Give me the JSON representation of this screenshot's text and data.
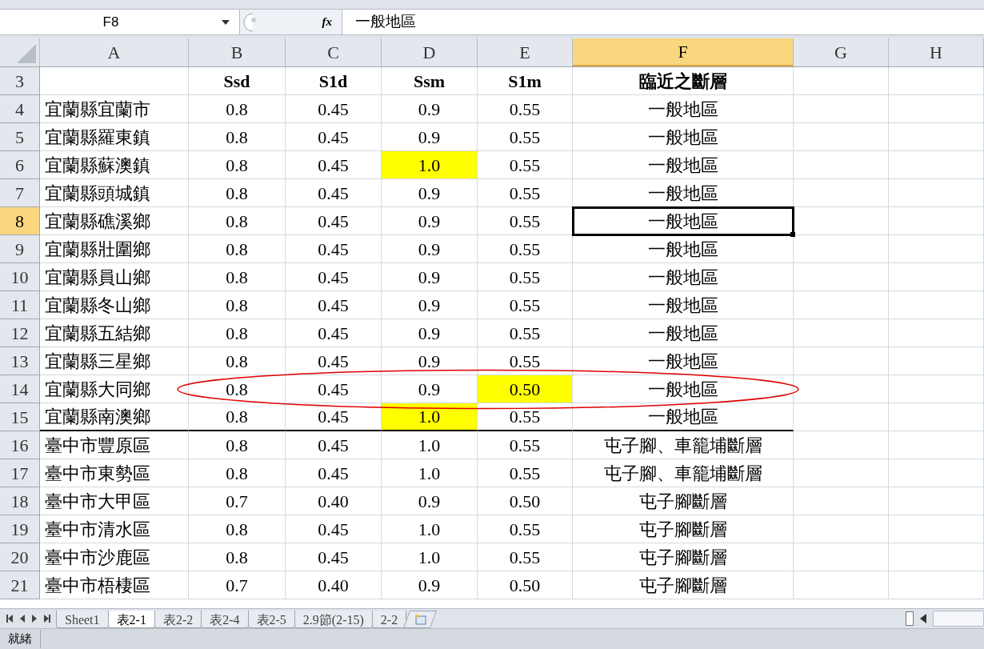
{
  "formula_bar": {
    "name_box": "F8",
    "fx": "fx",
    "formula": "一般地區"
  },
  "columns": [
    {
      "label": "A",
      "selected": false
    },
    {
      "label": "B",
      "selected": false
    },
    {
      "label": "C",
      "selected": false
    },
    {
      "label": "D",
      "selected": false
    },
    {
      "label": "E",
      "selected": false
    },
    {
      "label": "F",
      "selected": true
    },
    {
      "label": "G",
      "selected": false
    },
    {
      "label": "H",
      "selected": false
    }
  ],
  "rows": [
    {
      "number": "3",
      "kind": "header",
      "selected": false,
      "circled": false,
      "border_below": false,
      "cells": [
        {
          "text": "",
          "highlighted": false
        },
        {
          "text": "Ssd",
          "highlighted": false
        },
        {
          "text": "S1d",
          "highlighted": false
        },
        {
          "text": "Ssm",
          "highlighted": false
        },
        {
          "text": "S1m",
          "highlighted": false
        },
        {
          "text": "臨近之斷層",
          "highlighted": false
        }
      ]
    },
    {
      "number": "4",
      "kind": "data",
      "selected": false,
      "circled": false,
      "border_below": false,
      "cells": [
        {
          "text": "宜蘭縣宜蘭市",
          "highlighted": false
        },
        {
          "text": "0.8",
          "highlighted": false
        },
        {
          "text": "0.45",
          "highlighted": false
        },
        {
          "text": "0.9",
          "highlighted": false
        },
        {
          "text": "0.55",
          "highlighted": false
        },
        {
          "text": "一般地區",
          "highlighted": false
        }
      ]
    },
    {
      "number": "5",
      "kind": "data",
      "selected": false,
      "circled": false,
      "border_below": false,
      "cells": [
        {
          "text": "宜蘭縣羅東鎮",
          "highlighted": false
        },
        {
          "text": "0.8",
          "highlighted": false
        },
        {
          "text": "0.45",
          "highlighted": false
        },
        {
          "text": "0.9",
          "highlighted": false
        },
        {
          "text": "0.55",
          "highlighted": false
        },
        {
          "text": "一般地區",
          "highlighted": false
        }
      ]
    },
    {
      "number": "6",
      "kind": "data",
      "selected": false,
      "circled": false,
      "border_below": false,
      "cells": [
        {
          "text": "宜蘭縣蘇澳鎮",
          "highlighted": false
        },
        {
          "text": "0.8",
          "highlighted": false
        },
        {
          "text": "0.45",
          "highlighted": false
        },
        {
          "text": "1.0",
          "highlighted": true
        },
        {
          "text": "0.55",
          "highlighted": false
        },
        {
          "text": "一般地區",
          "highlighted": false
        }
      ]
    },
    {
      "number": "7",
      "kind": "data",
      "selected": false,
      "circled": false,
      "border_below": false,
      "cells": [
        {
          "text": "宜蘭縣頭城鎮",
          "highlighted": false
        },
        {
          "text": "0.8",
          "highlighted": false
        },
        {
          "text": "0.45",
          "highlighted": false
        },
        {
          "text": "0.9",
          "highlighted": false
        },
        {
          "text": "0.55",
          "highlighted": false
        },
        {
          "text": "一般地區",
          "highlighted": false
        }
      ]
    },
    {
      "number": "8",
      "kind": "data",
      "selected": true,
      "circled": false,
      "border_below": false,
      "cells": [
        {
          "text": "宜蘭縣礁溪鄉",
          "highlighted": false
        },
        {
          "text": "0.8",
          "highlighted": false
        },
        {
          "text": "0.45",
          "highlighted": false
        },
        {
          "text": "0.9",
          "highlighted": false
        },
        {
          "text": "0.55",
          "highlighted": false
        },
        {
          "text": "一般地區",
          "highlighted": false,
          "selected": true
        }
      ]
    },
    {
      "number": "9",
      "kind": "data",
      "selected": false,
      "circled": false,
      "border_below": false,
      "cells": [
        {
          "text": "宜蘭縣壯圍鄉",
          "highlighted": false
        },
        {
          "text": "0.8",
          "highlighted": false
        },
        {
          "text": "0.45",
          "highlighted": false
        },
        {
          "text": "0.9",
          "highlighted": false
        },
        {
          "text": "0.55",
          "highlighted": false
        },
        {
          "text": "一般地區",
          "highlighted": false
        }
      ]
    },
    {
      "number": "10",
      "kind": "data",
      "selected": false,
      "circled": false,
      "border_below": false,
      "cells": [
        {
          "text": "宜蘭縣員山鄉",
          "highlighted": false
        },
        {
          "text": "0.8",
          "highlighted": false
        },
        {
          "text": "0.45",
          "highlighted": false
        },
        {
          "text": "0.9",
          "highlighted": false
        },
        {
          "text": "0.55",
          "highlighted": false
        },
        {
          "text": "一般地區",
          "highlighted": false
        }
      ]
    },
    {
      "number": "11",
      "kind": "data",
      "selected": false,
      "circled": false,
      "border_below": false,
      "cells": [
        {
          "text": "宜蘭縣冬山鄉",
          "highlighted": false
        },
        {
          "text": "0.8",
          "highlighted": false
        },
        {
          "text": "0.45",
          "highlighted": false
        },
        {
          "text": "0.9",
          "highlighted": false
        },
        {
          "text": "0.55",
          "highlighted": false
        },
        {
          "text": "一般地區",
          "highlighted": false
        }
      ]
    },
    {
      "number": "12",
      "kind": "data",
      "selected": false,
      "circled": false,
      "border_below": false,
      "cells": [
        {
          "text": "宜蘭縣五結鄉",
          "highlighted": false
        },
        {
          "text": "0.8",
          "highlighted": false
        },
        {
          "text": "0.45",
          "highlighted": false
        },
        {
          "text": "0.9",
          "highlighted": false
        },
        {
          "text": "0.55",
          "highlighted": false
        },
        {
          "text": "一般地區",
          "highlighted": false
        }
      ]
    },
    {
      "number": "13",
      "kind": "data",
      "selected": false,
      "circled": false,
      "border_below": false,
      "cells": [
        {
          "text": "宜蘭縣三星鄉",
          "highlighted": false
        },
        {
          "text": "0.8",
          "highlighted": false
        },
        {
          "text": "0.45",
          "highlighted": false
        },
        {
          "text": "0.9",
          "highlighted": false
        },
        {
          "text": "0.55",
          "highlighted": false
        },
        {
          "text": "一般地區",
          "highlighted": false
        }
      ]
    },
    {
      "number": "14",
      "kind": "data",
      "selected": false,
      "circled": true,
      "border_below": false,
      "cells": [
        {
          "text": "宜蘭縣大同鄉",
          "highlighted": false
        },
        {
          "text": "0.8",
          "highlighted": false
        },
        {
          "text": "0.45",
          "highlighted": false
        },
        {
          "text": "0.9",
          "highlighted": false
        },
        {
          "text": "0.50",
          "highlighted": true
        },
        {
          "text": "一般地區",
          "highlighted": false
        }
      ]
    },
    {
      "number": "15",
      "kind": "data",
      "selected": false,
      "circled": false,
      "border_below": true,
      "cells": [
        {
          "text": "宜蘭縣南澳鄉",
          "highlighted": false
        },
        {
          "text": "0.8",
          "highlighted": false
        },
        {
          "text": "0.45",
          "highlighted": false
        },
        {
          "text": "1.0",
          "highlighted": true
        },
        {
          "text": "0.55",
          "highlighted": false
        },
        {
          "text": "一般地區",
          "highlighted": false
        }
      ]
    },
    {
      "number": "16",
      "kind": "data",
      "selected": false,
      "circled": false,
      "border_below": false,
      "cells": [
        {
          "text": "臺中市豐原區",
          "highlighted": false
        },
        {
          "text": "0.8",
          "highlighted": false
        },
        {
          "text": "0.45",
          "highlighted": false
        },
        {
          "text": "1.0",
          "highlighted": false
        },
        {
          "text": "0.55",
          "highlighted": false
        },
        {
          "text": "屯子腳、車籠埔斷層",
          "highlighted": false
        }
      ]
    },
    {
      "number": "17",
      "kind": "data",
      "selected": false,
      "circled": false,
      "border_below": false,
      "cells": [
        {
          "text": "臺中市東勢區",
          "highlighted": false
        },
        {
          "text": "0.8",
          "highlighted": false
        },
        {
          "text": "0.45",
          "highlighted": false
        },
        {
          "text": "1.0",
          "highlighted": false
        },
        {
          "text": "0.55",
          "highlighted": false
        },
        {
          "text": "屯子腳、車籠埔斷層",
          "highlighted": false
        }
      ]
    },
    {
      "number": "18",
      "kind": "data",
      "selected": false,
      "circled": false,
      "border_below": false,
      "cells": [
        {
          "text": "臺中市大甲區",
          "highlighted": false
        },
        {
          "text": "0.7",
          "highlighted": false
        },
        {
          "text": "0.40",
          "highlighted": false
        },
        {
          "text": "0.9",
          "highlighted": false
        },
        {
          "text": "0.50",
          "highlighted": false
        },
        {
          "text": "屯子腳斷層",
          "highlighted": false
        }
      ]
    },
    {
      "number": "19",
      "kind": "data",
      "selected": false,
      "circled": false,
      "border_below": false,
      "cells": [
        {
          "text": "臺中市清水區",
          "highlighted": false
        },
        {
          "text": "0.8",
          "highlighted": false
        },
        {
          "text": "0.45",
          "highlighted": false
        },
        {
          "text": "1.0",
          "highlighted": false
        },
        {
          "text": "0.55",
          "highlighted": false
        },
        {
          "text": "屯子腳斷層",
          "highlighted": false
        }
      ]
    },
    {
      "number": "20",
      "kind": "data",
      "selected": false,
      "circled": false,
      "border_below": false,
      "cells": [
        {
          "text": "臺中市沙鹿區",
          "highlighted": false
        },
        {
          "text": "0.8",
          "highlighted": false
        },
        {
          "text": "0.45",
          "highlighted": false
        },
        {
          "text": "1.0",
          "highlighted": false
        },
        {
          "text": "0.55",
          "highlighted": false
        },
        {
          "text": "屯子腳斷層",
          "highlighted": false
        }
      ]
    },
    {
      "number": "21",
      "kind": "data",
      "selected": false,
      "circled": false,
      "border_below": false,
      "cells": [
        {
          "text": "臺中市梧棲區",
          "highlighted": false
        },
        {
          "text": "0.7",
          "highlighted": false
        },
        {
          "text": "0.40",
          "highlighted": false
        },
        {
          "text": "0.9",
          "highlighted": false
        },
        {
          "text": "0.50",
          "highlighted": false
        },
        {
          "text": "屯子腳斷層",
          "highlighted": false
        }
      ]
    }
  ],
  "sheet_tabs": [
    {
      "label": "Sheet1",
      "selected": false
    },
    {
      "label": "表2-1",
      "selected": true
    },
    {
      "label": "表2-2",
      "selected": false
    },
    {
      "label": "表2-4",
      "selected": false
    },
    {
      "label": "表2-5",
      "selected": false
    },
    {
      "label": "2.9節(2-15)",
      "selected": false
    },
    {
      "label": "2-2",
      "selected": false
    }
  ],
  "status_bar": {
    "text": "就緒"
  }
}
